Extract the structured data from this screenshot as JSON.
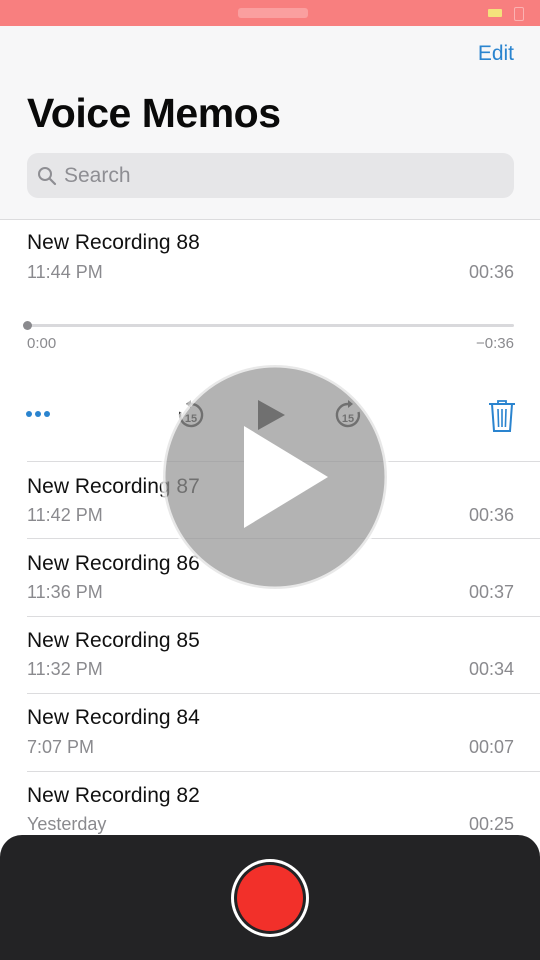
{
  "nav": {
    "edit_label": "Edit",
    "title": "Voice Memos"
  },
  "search": {
    "placeholder": "Search"
  },
  "expanded": {
    "title": "New Recording 88",
    "time": "11:44 PM",
    "duration": "00:36",
    "elapsed": "0:00",
    "remaining": "−0:36",
    "progress": 0.0,
    "skip_back_label": "15",
    "skip_forward_label": "15"
  },
  "recordings": [
    {
      "title": "New Recording 87",
      "time": "11:42 PM",
      "duration": "00:36"
    },
    {
      "title": "New Recording 86",
      "time": "11:36 PM",
      "duration": "00:37"
    },
    {
      "title": "New Recording 85",
      "time": "11:32 PM",
      "duration": "00:34"
    },
    {
      "title": "New Recording 84",
      "time": "7:07 PM",
      "duration": "00:07"
    },
    {
      "title": "New Recording 82",
      "time": "Yesterday",
      "duration": "00:25"
    }
  ],
  "colors": {
    "accent": "#2a84cf",
    "status_bar": "#f87f7f",
    "record": "#f2302a",
    "bottom_bar": "#232325"
  },
  "icons": {
    "search": "search-icon",
    "more": "more-icon",
    "skip_back": "skip-back-15-icon",
    "play": "play-icon",
    "skip_forward": "skip-forward-15-icon",
    "trash": "trash-icon",
    "record": "record-icon",
    "overlay_play": "video-play-overlay-icon"
  }
}
